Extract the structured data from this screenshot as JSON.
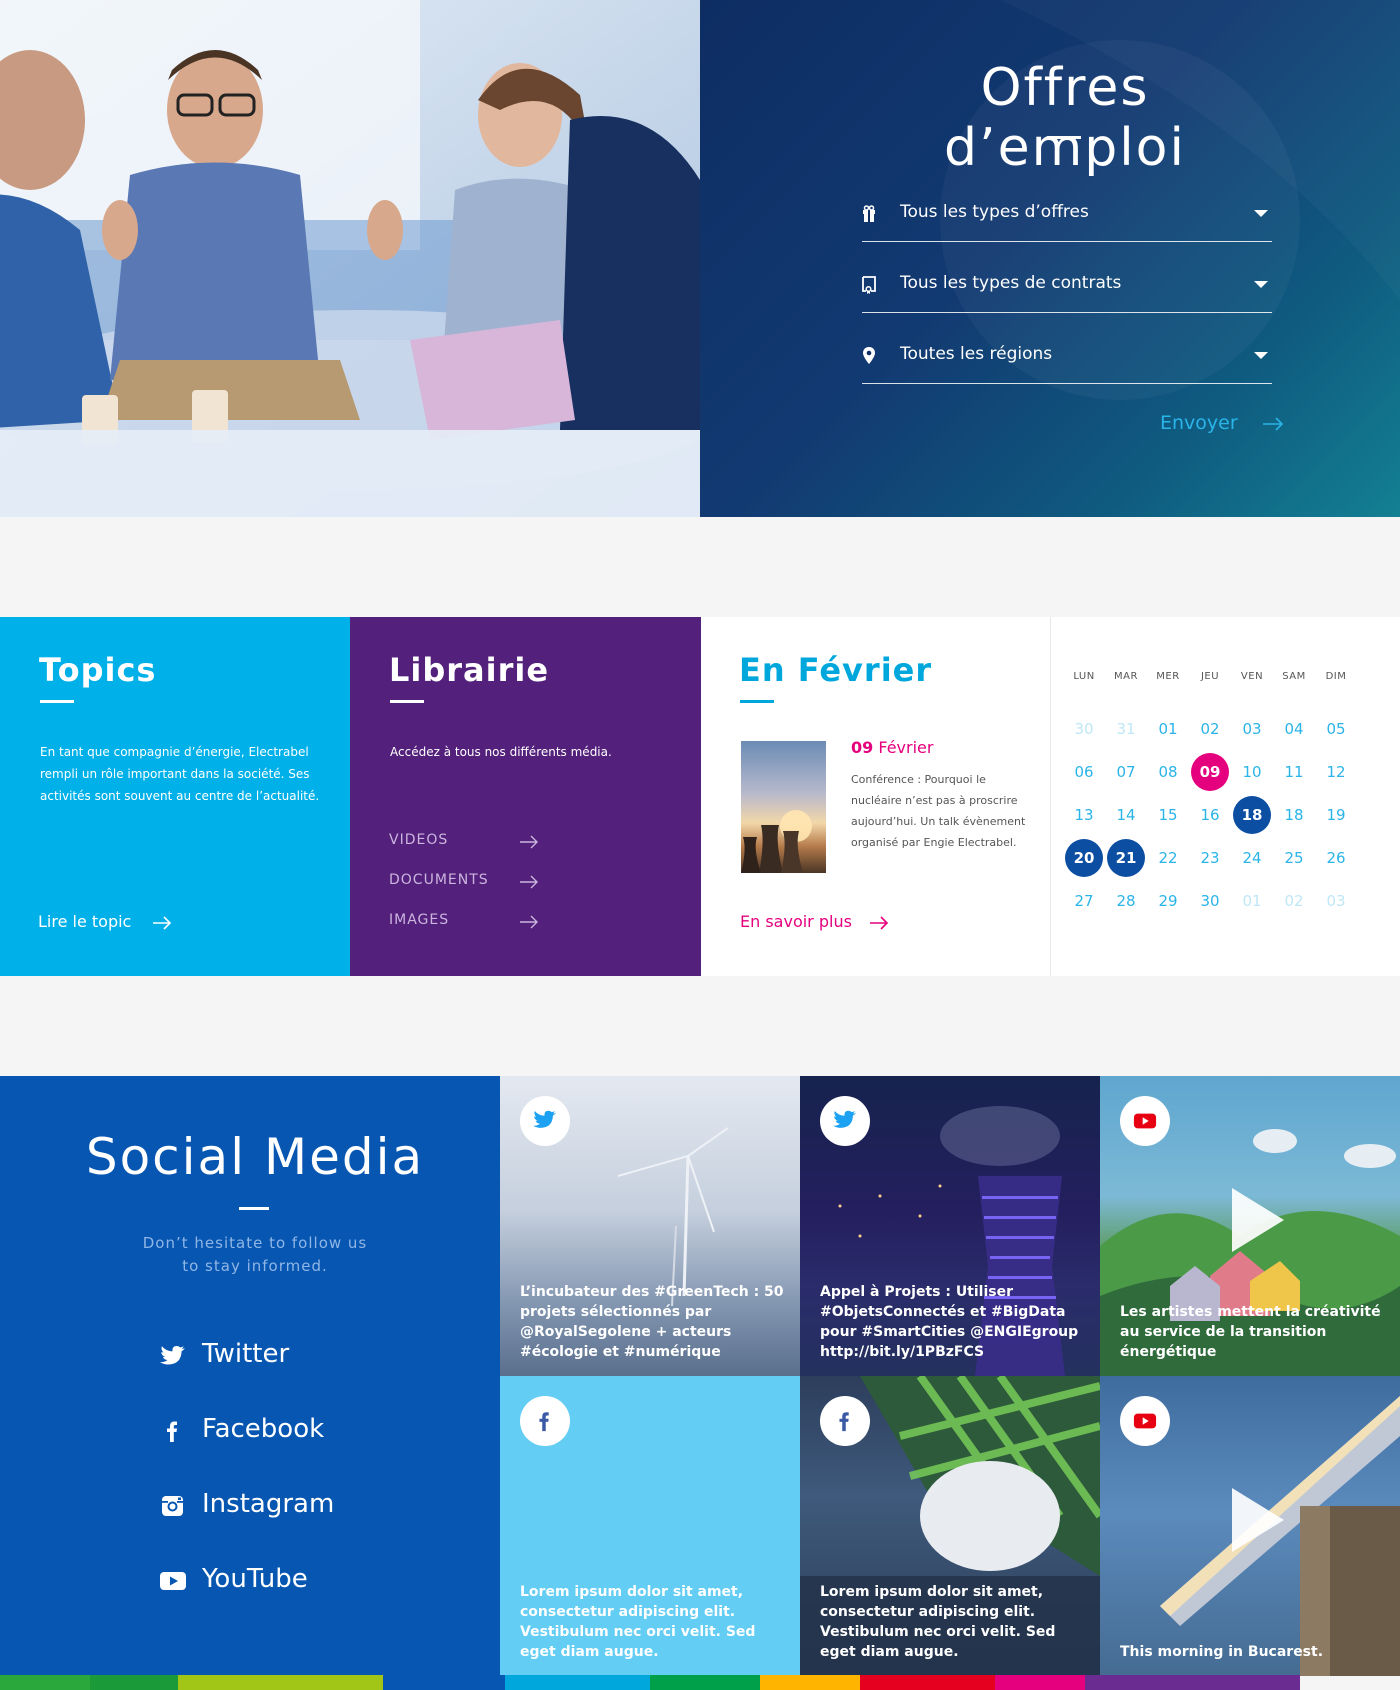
{
  "jobs": {
    "title": "Offres d’emploi",
    "filters": [
      {
        "label": "Tous les types d’offres",
        "icon": "gift-icon"
      },
      {
        "label": "Tous les types de contrats",
        "icon": "contract-icon"
      },
      {
        "label": "Toutes les régions",
        "icon": "location-pin-icon"
      }
    ],
    "submit_label": "Envoyer"
  },
  "topics": {
    "title": "Topics",
    "text": "En tant que compagnie d’énergie, Electrabel rempli un rôle important dans la société. Ses activités sont souvent au centre de l’actualité.",
    "link": "Lire le topic"
  },
  "librairie": {
    "title": "Librairie",
    "text": "Accédez à tous nos différents média.",
    "items": [
      "VIDEOS",
      "DOCUMENTS",
      "IMAGES"
    ]
  },
  "event": {
    "title": "En Février",
    "date_num": "09",
    "date_month": "Février",
    "description": "Conférence : Pourquoi le nucléaire n’est pas à proscrire aujourd’hui. Un talk évènement organisé par Engie Electrabel.",
    "link": "En savoir plus"
  },
  "calendar": {
    "weekdays": [
      "LUN",
      "MAR",
      "MER",
      "JEU",
      "VEN",
      "SAM",
      "DIM"
    ],
    "weeks": [
      [
        {
          "d": "30",
          "s": "muted"
        },
        {
          "d": "31",
          "s": "muted"
        },
        {
          "d": "01"
        },
        {
          "d": "02"
        },
        {
          "d": "03"
        },
        {
          "d": "04"
        },
        {
          "d": "05"
        }
      ],
      [
        {
          "d": "06"
        },
        {
          "d": "07"
        },
        {
          "d": "08"
        },
        {
          "d": "09",
          "s": "event"
        },
        {
          "d": "10"
        },
        {
          "d": "11"
        },
        {
          "d": "12"
        }
      ],
      [
        {
          "d": "13"
        },
        {
          "d": "14"
        },
        {
          "d": "15"
        },
        {
          "d": "16"
        },
        {
          "d": "18",
          "s": "sel"
        },
        {
          "d": "18"
        },
        {
          "d": "19"
        }
      ],
      [
        {
          "d": "20",
          "s": "sel"
        },
        {
          "d": "21",
          "s": "sel"
        },
        {
          "d": "22"
        },
        {
          "d": "23"
        },
        {
          "d": "24"
        },
        {
          "d": "25"
        },
        {
          "d": "26"
        }
      ],
      [
        {
          "d": "27"
        },
        {
          "d": "28"
        },
        {
          "d": "29"
        },
        {
          "d": "30"
        },
        {
          "d": "01",
          "s": "muted"
        },
        {
          "d": "02",
          "s": "muted"
        },
        {
          "d": "03",
          "s": "muted"
        }
      ]
    ]
  },
  "social": {
    "title": "Social Media",
    "subtitle_line1": "Don’t hesitate to follow us",
    "subtitle_line2": "to stay informed.",
    "links": [
      {
        "label": "Twitter",
        "icon": "twitter-icon"
      },
      {
        "label": "Facebook",
        "icon": "facebook-icon"
      },
      {
        "label": "Instagram",
        "icon": "instagram-icon"
      },
      {
        "label": "YouTube",
        "icon": "youtube-icon"
      }
    ],
    "tiles": [
      {
        "network": "twitter",
        "caption": "L’incubateur des #GreenTech : 50 projets sélectionnés par @RoyalSegolene + acteurs #écologie et #numérique"
      },
      {
        "network": "twitter",
        "caption": "Appel à Projets : Utiliser #ObjetsConnectés et #BigData pour #SmartCities @ENGIEgroup http://bit.ly/1PBzFCS"
      },
      {
        "network": "youtube",
        "caption": "Les artistes mettent la créativité au service de la transition énergétique"
      },
      {
        "network": "facebook",
        "caption": "Lorem ipsum dolor sit amet, consectetur adipiscing elit. Vestibulum nec orci velit. Sed eget diam augue."
      },
      {
        "network": "facebook",
        "caption": "Lorem ipsum dolor sit amet, consectetur adipiscing elit. Vestibulum nec orci velit. Sed eget diam augue."
      },
      {
        "network": "youtube",
        "caption": "This morning in Bucarest."
      }
    ]
  },
  "colors": {
    "navy": "#0d2d63",
    "cyan": "#00b0e8",
    "purple": "#53207b",
    "magenta": "#e5007e",
    "social_blue": "#0756b1",
    "strip": [
      "#2aa83b",
      "#1a9a39",
      "#a2c617",
      "#0756b1",
      "#00a7dc",
      "#00a04a",
      "#ffb400",
      "#e6001f",
      "#e5007e",
      "#6b2c91"
    ]
  }
}
